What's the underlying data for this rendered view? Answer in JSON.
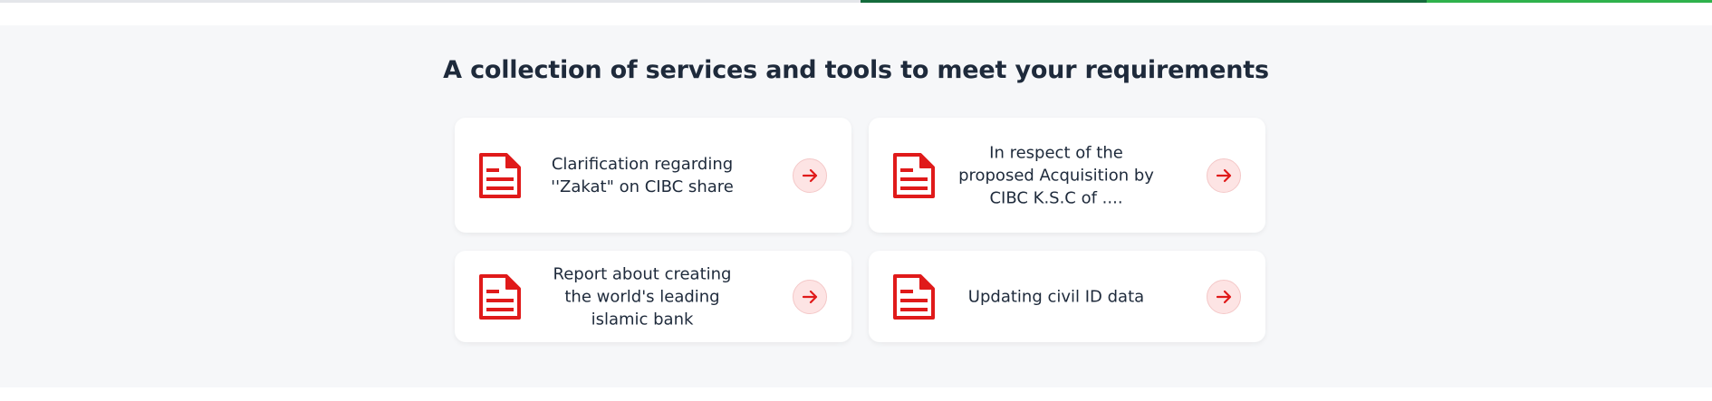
{
  "section": {
    "heading": "A collection of services and tools to meet your requirements"
  },
  "cards": [
    {
      "label": "Clarification regarding ''Zakat\" on CIBC share",
      "icon": "document-icon"
    },
    {
      "label": "In respect of the proposed Acquisition by CIBC K.S.C of ....",
      "icon": "document-icon"
    },
    {
      "label": "Report about creating the world's leading islamic bank",
      "icon": "document-icon"
    },
    {
      "label": "Updating civil ID data",
      "icon": "document-icon"
    }
  ],
  "colors": {
    "accent": "#e01a1a",
    "arrow_bg": "#fde4e4",
    "heading": "#1e2a3b",
    "section_bg": "#f6f7f9",
    "progress_dark": "#156c3c",
    "progress_light": "#2fb24c"
  }
}
